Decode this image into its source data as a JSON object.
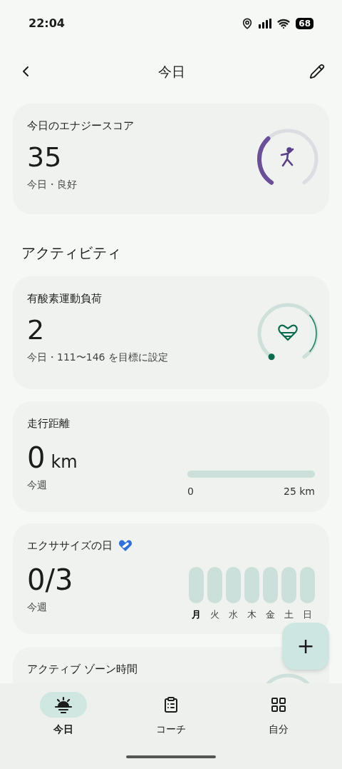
{
  "status_bar": {
    "time": "22:04",
    "battery": "68"
  },
  "header": {
    "title": "今日"
  },
  "energy": {
    "title": "今日のエナジースコア",
    "value": "35",
    "caption": "今日・良好"
  },
  "section_title": "アクティビティ",
  "cardio": {
    "title": "有酸素運動負荷",
    "value": "2",
    "caption": "今日・111〜146 を目標に設定"
  },
  "distance": {
    "title": "走行距離",
    "value": "0",
    "unit": "km",
    "caption": "今週",
    "min_label": "0",
    "max_label": "25 km"
  },
  "exercise": {
    "title": "エクササイズの日",
    "value": "0",
    "total": "/3",
    "caption": "今週",
    "days": [
      {
        "label": "月",
        "selected": true,
        "done": false
      },
      {
        "label": "火",
        "selected": false,
        "done": false
      },
      {
        "label": "水",
        "selected": false,
        "done": false
      },
      {
        "label": "木",
        "selected": false,
        "done": false
      },
      {
        "label": "金",
        "selected": false,
        "done": false
      },
      {
        "label": "土",
        "selected": false,
        "done": false
      },
      {
        "label": "日",
        "selected": false,
        "done": false
      }
    ]
  },
  "zone": {
    "title": "アクティブ ゾーン時間"
  },
  "fab": {
    "label": "+"
  },
  "nav": [
    {
      "kind": "today",
      "label": "今日",
      "selected": true
    },
    {
      "kind": "coach",
      "label": "コーチ",
      "selected": false
    },
    {
      "kind": "me",
      "label": "自分",
      "selected": false
    }
  ]
}
